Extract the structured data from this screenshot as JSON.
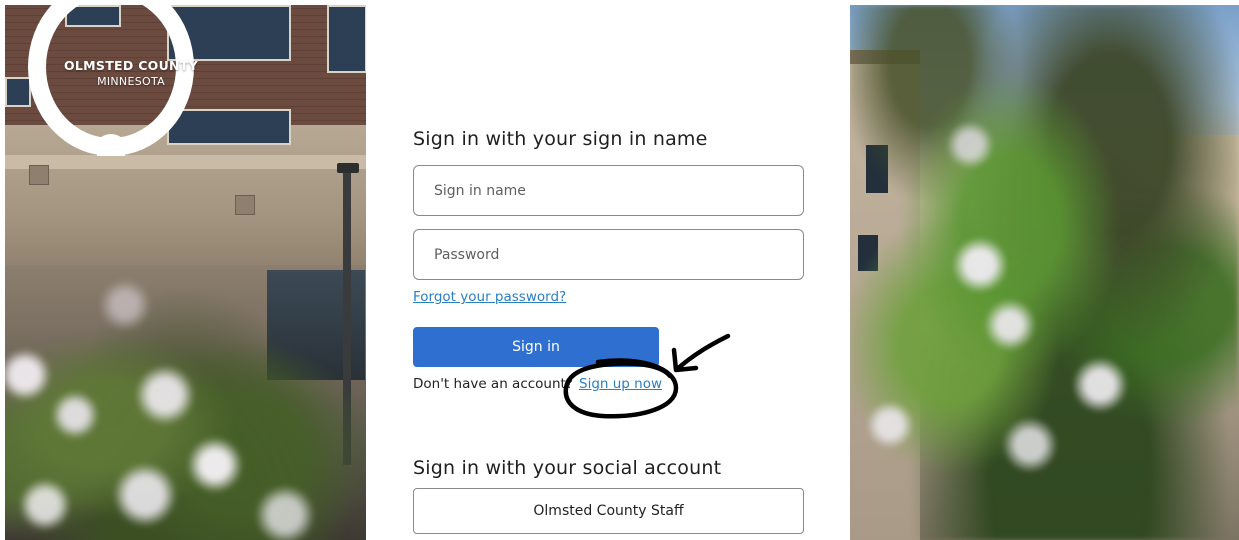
{
  "logo": {
    "line1": "OLMSTED COUNTY",
    "line2": "MINNESOTA"
  },
  "local_signin": {
    "heading": "Sign in with your sign in name",
    "username_placeholder": "Sign in name",
    "username_value": "",
    "password_placeholder": "Password",
    "password_value": "",
    "forgot_label": "Forgot your password?",
    "signin_label": "Sign in",
    "no_account_text": "Don't have an account?",
    "signup_label": "Sign up now"
  },
  "social_signin": {
    "heading": "Sign in with your social account",
    "provider_label": "Olmsted County Staff"
  },
  "colors": {
    "primary_button": "#2f6fcf",
    "link": "#2a7fc1",
    "annotation_ink": "#000000"
  }
}
